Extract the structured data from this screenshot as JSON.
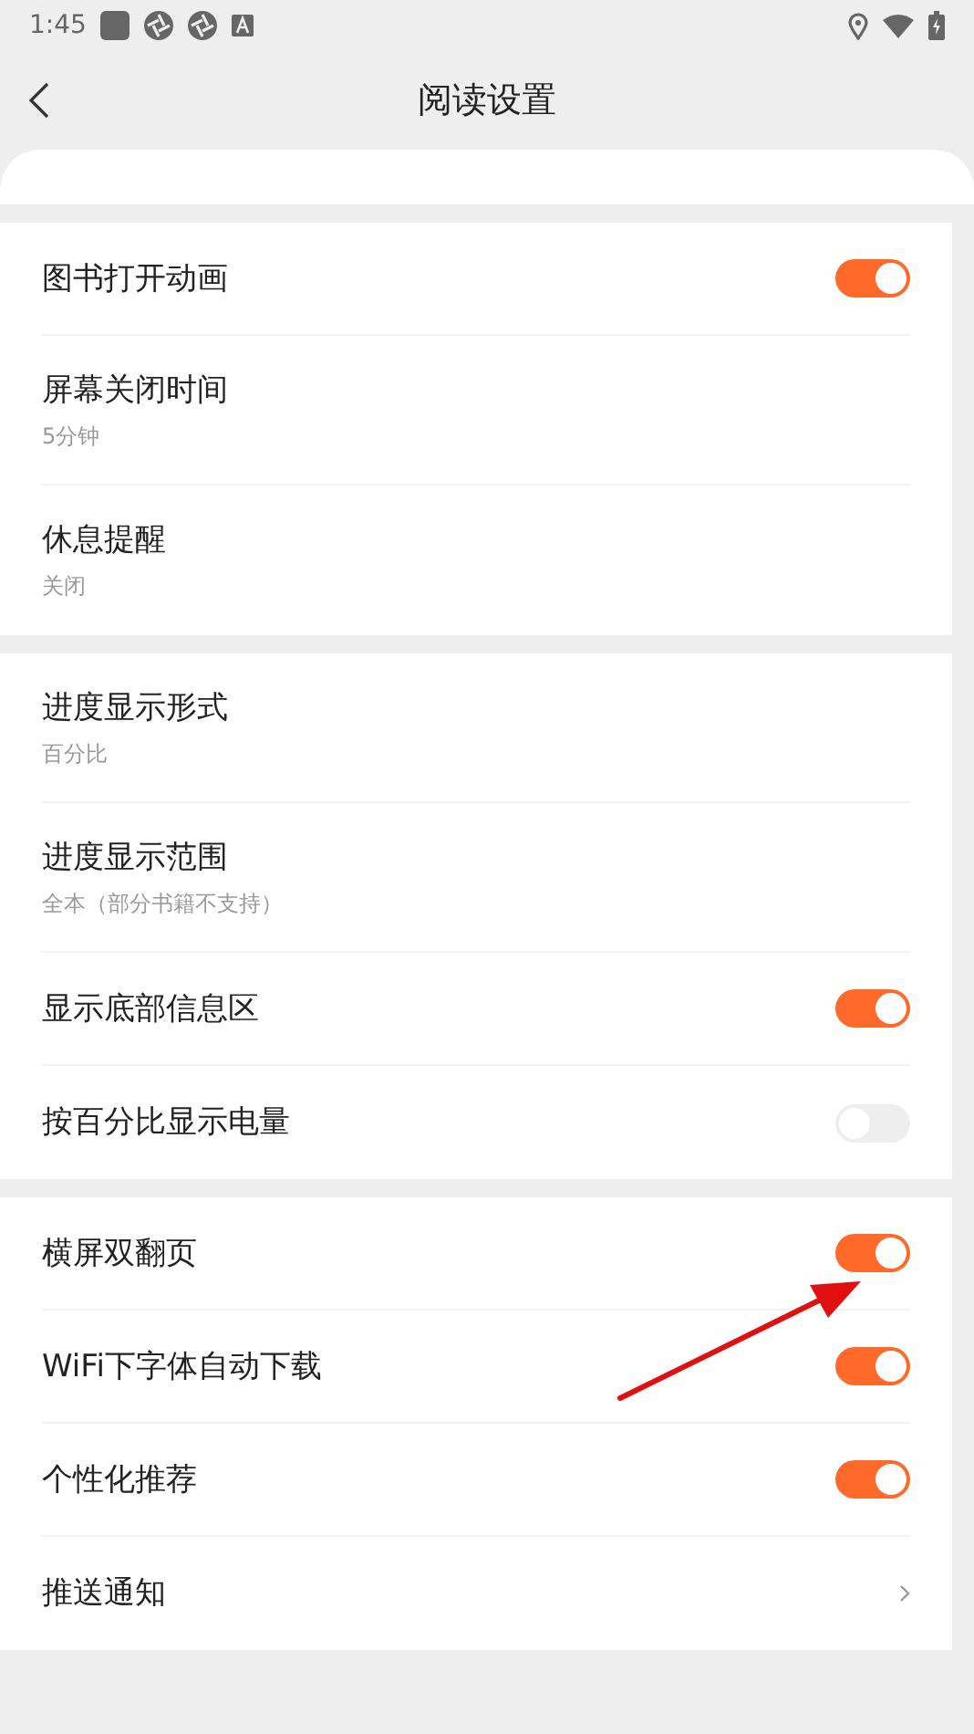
{
  "status_bar": {
    "time": "1:45"
  },
  "header": {
    "title": "阅读设置"
  },
  "groups": [
    {
      "items": [
        {
          "kind": "switch",
          "label": "图书打开动画",
          "on": true
        },
        {
          "kind": "value",
          "label": "屏幕关闭时间",
          "value": "5分钟"
        },
        {
          "kind": "value",
          "label": "休息提醒",
          "value": "关闭"
        }
      ]
    },
    {
      "items": [
        {
          "kind": "value",
          "label": "进度显示形式",
          "value": "百分比"
        },
        {
          "kind": "value",
          "label": "进度显示范围",
          "value": "全本（部分书籍不支持）"
        },
        {
          "kind": "switch",
          "label": "显示底部信息区",
          "on": true
        },
        {
          "kind": "switch",
          "label": "按百分比显示电量",
          "on": false
        }
      ]
    },
    {
      "items": [
        {
          "kind": "switch",
          "label": "横屏双翻页",
          "on": true
        },
        {
          "kind": "switch",
          "label": "WiFi下字体自动下载",
          "on": true
        },
        {
          "kind": "switch",
          "label": "个性化推荐",
          "on": true
        },
        {
          "kind": "link",
          "label": "推送通知"
        }
      ]
    }
  ]
}
